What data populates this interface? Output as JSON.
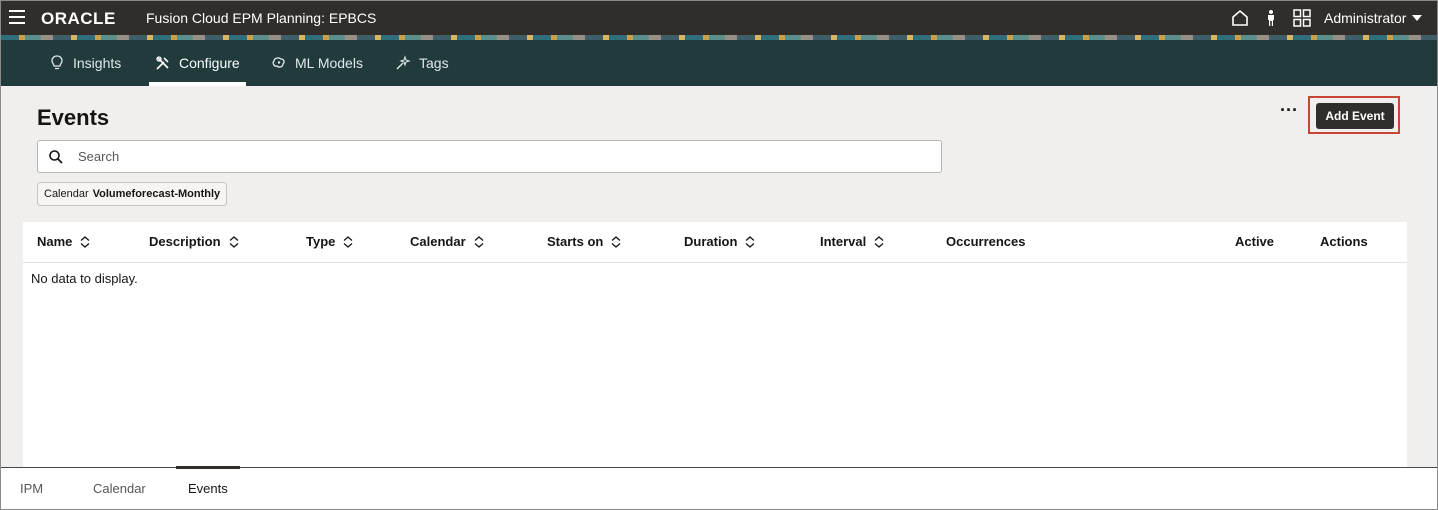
{
  "topbar": {
    "logo": "ORACLE",
    "app_title": "Fusion Cloud EPM Planning:  EPBCS",
    "icons": [
      "menu-icon",
      "home-icon",
      "accessibility-icon",
      "navigator-icon"
    ],
    "user": "Administrator"
  },
  "tabs": [
    {
      "label": "Insights",
      "icon": "insights-icon",
      "active": false
    },
    {
      "label": "Configure",
      "icon": "configure-icon",
      "active": true
    },
    {
      "label": "ML Models",
      "icon": "ml-models-icon",
      "active": false
    },
    {
      "label": "Tags",
      "icon": "tags-icon",
      "active": false
    }
  ],
  "page": {
    "title": "Events",
    "more_label": "···",
    "add_button": "Add Event",
    "search_placeholder": "Search",
    "filter_chip": {
      "label": "Calendar",
      "value": "Volumeforecast-Monthly"
    }
  },
  "table": {
    "columns": [
      {
        "label": "Name",
        "sortable": true
      },
      {
        "label": "Description",
        "sortable": true
      },
      {
        "label": "Type",
        "sortable": true
      },
      {
        "label": "Calendar",
        "sortable": true
      },
      {
        "label": "Starts on",
        "sortable": true
      },
      {
        "label": "Duration",
        "sortable": true
      },
      {
        "label": "Interval",
        "sortable": true
      },
      {
        "label": "Occurrences",
        "sortable": false
      },
      {
        "label": "Active",
        "sortable": false
      },
      {
        "label": "Actions",
        "sortable": false
      }
    ],
    "empty_message": "No data to display."
  },
  "bottom_tabs": [
    {
      "label": "IPM",
      "active": false
    },
    {
      "label": "Calendar",
      "active": false
    },
    {
      "label": "Events",
      "active": true
    }
  ],
  "colors": {
    "topbar_bg": "#312d2a",
    "tabbar_bg": "#213a3c",
    "header_bg": "#f1efed",
    "highlight": "#c74634"
  }
}
